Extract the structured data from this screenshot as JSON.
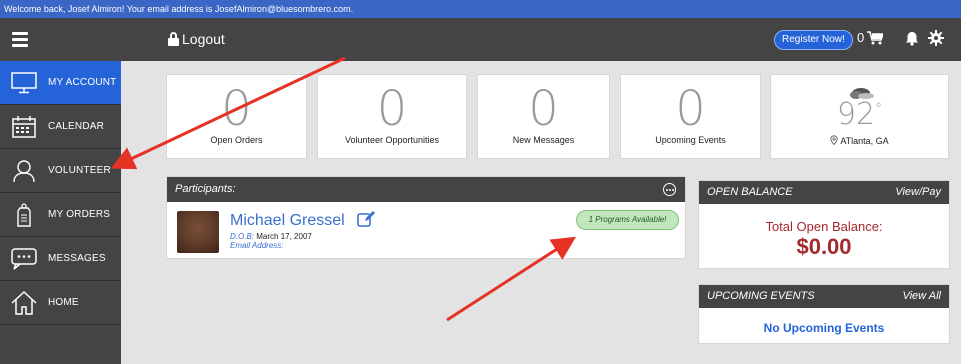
{
  "welcome_bar": {
    "text": "Welcome back, Josef Almiron! Your email address is JosefAlmiron@bluesombrero.com."
  },
  "header": {
    "logout_label": "Logout",
    "register_label": "Register Now!",
    "cart_count": "0"
  },
  "sidebar": {
    "items": [
      {
        "label": "MY ACCOUNT",
        "icon": "monitor-icon",
        "active": true
      },
      {
        "label": "CALENDAR",
        "icon": "calendar-icon",
        "active": false
      },
      {
        "label": "VOLUNTEER",
        "icon": "person-icon",
        "active": false
      },
      {
        "label": "MY ORDERS",
        "icon": "tag-icon",
        "active": false
      },
      {
        "label": "MESSAGES",
        "icon": "chat-icon",
        "active": false
      },
      {
        "label": "HOME",
        "icon": "house-icon",
        "active": false
      }
    ]
  },
  "stats": [
    {
      "value": "0",
      "label": "Open Orders"
    },
    {
      "value": "0",
      "label": "Volunteer Opportunities"
    },
    {
      "value": "0",
      "label": "New Messages"
    },
    {
      "value": "0",
      "label": "Upcoming Events"
    }
  ],
  "weather": {
    "temp": "92",
    "degree": "°",
    "location": "ATlanta, GA"
  },
  "participants": {
    "title": "Participants:",
    "person": {
      "name": "Michael Gressel",
      "dob_label": "D.O.B:",
      "dob_value": "March 17, 2007",
      "email_label": "Email Address:"
    },
    "programs_badge": "1 Programs Available!"
  },
  "open_balance": {
    "title": "OPEN BALANCE",
    "action": "View/Pay",
    "total_label": "Total Open Balance:",
    "total_value": "$0.00"
  },
  "upcoming_events": {
    "title": "UPCOMING EVENTS",
    "action": "View All",
    "empty_text": "No Upcoming Events"
  },
  "colors": {
    "accent": "#2563d8",
    "header_bg": "#444444",
    "balance_red": "#a4292e",
    "annotation_arrow": "#e53225"
  }
}
